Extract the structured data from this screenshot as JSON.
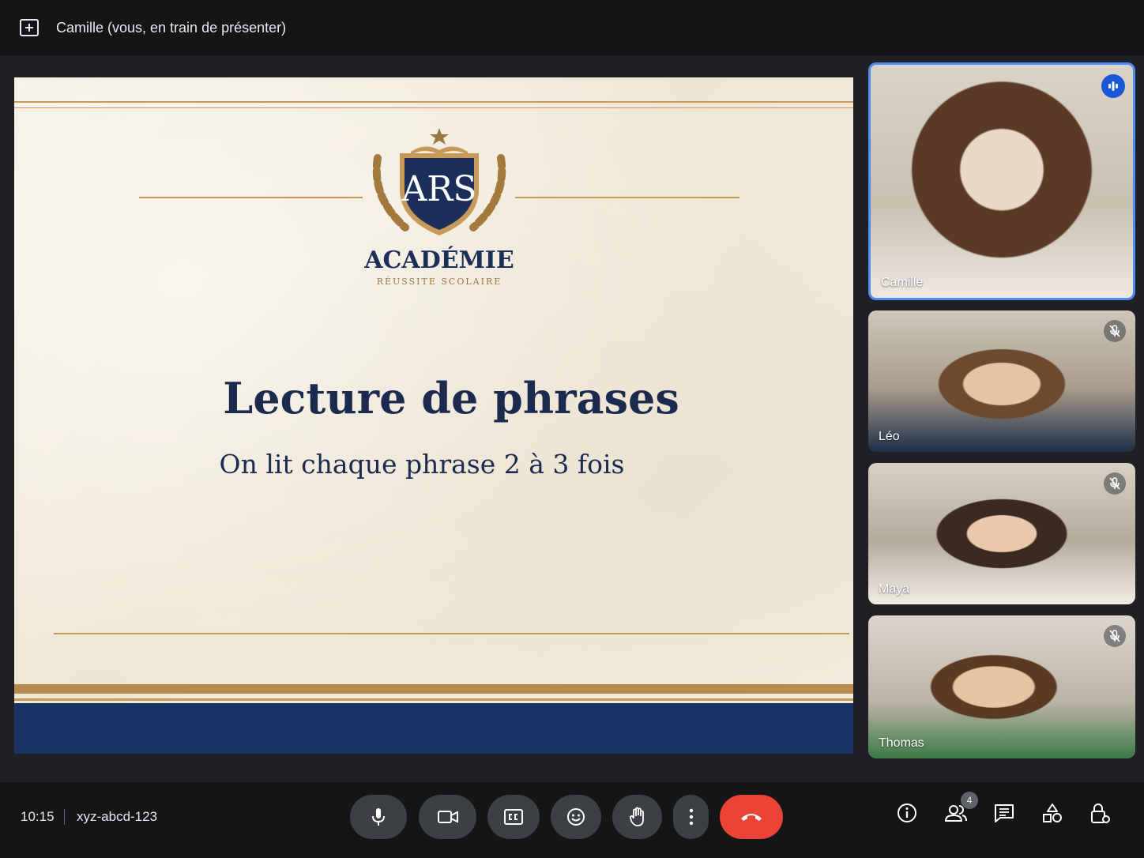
{
  "topbar": {
    "presenting_label": "Camille (vous, en train de présenter)"
  },
  "slide": {
    "logo_letters": "ARS",
    "logo_name": "ACADÉMIE",
    "logo_subtitle": "RÉUSSITE SCOLAIRE",
    "title": "Lecture de phrases",
    "subtitle": "On lit chaque phrase 2 à 3 fois",
    "colors": {
      "navy": "#1a3366",
      "gold": "#c79a5a",
      "paper": "#f3ecdd"
    }
  },
  "participants": [
    {
      "name": "Camille",
      "status": "speaking"
    },
    {
      "name": "Léo",
      "status": "muted"
    },
    {
      "name": "Maya",
      "status": "muted"
    },
    {
      "name": "Thomas",
      "status": "muted"
    }
  ],
  "bottombar": {
    "time": "10:15",
    "meeting_code": "xyz-abcd-123",
    "participants_count": "4",
    "controls": [
      "mic-icon",
      "camera-icon",
      "captions-icon",
      "emoji-icon",
      "raise-hand-icon",
      "more-options-icon",
      "end-call-icon"
    ],
    "right_controls": [
      "info-icon",
      "people-icon",
      "chat-icon",
      "activities-icon",
      "host-controls-icon"
    ],
    "accent": "#ea4335"
  }
}
